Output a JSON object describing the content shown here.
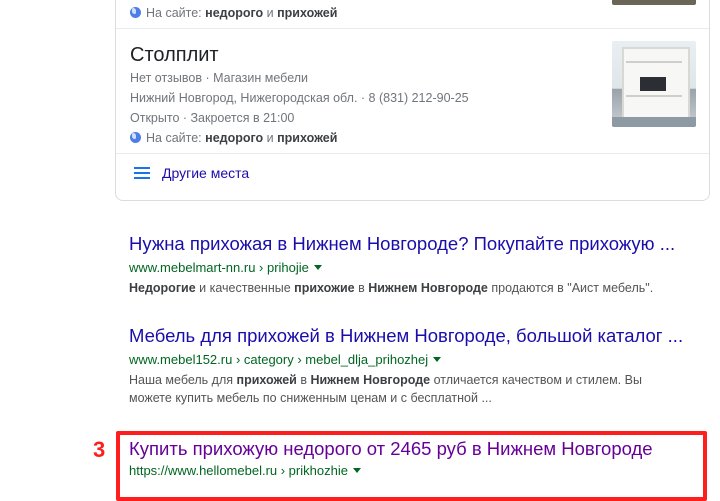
{
  "local_pack": {
    "top_place": {
      "site_label": "На сайте:",
      "site_kw1": "недорого",
      "site_and": "и",
      "site_kw2": "прихожей"
    },
    "place": {
      "name": "Столплит",
      "rating_line": "Нет отзывов · Магазин мебели",
      "address_line": "Нижний Новгород, Нижегородская обл. · 8 (831) 212-90-25",
      "hours_line": "Открыто · Закроется в 21:00",
      "site_label": "На сайте:",
      "site_kw1": "недорого",
      "site_and": "и",
      "site_kw2": "прихожей"
    },
    "more_places": "Другие места"
  },
  "results": [
    {
      "title": "Нужна прихожая в Нижнем Новгороде? Покупайте прихожую ...",
      "url": "www.mebelmart-nn.ru › prihojie",
      "snippet_parts": {
        "p1b": "Недорогие",
        "p2": " и качественные ",
        "p3b": "прихожие",
        "p4": " в ",
        "p5b": "Нижнем Новгороде",
        "p6": " продаются в \"Аист мебель\"."
      }
    },
    {
      "title": "Мебель для прихожей в Нижнем Новгороде, большой каталог ...",
      "url": "www.mebel152.ru › category › mebel_dlja_prihozhej",
      "snippet_parts": {
        "p1": "Наша мебель для ",
        "p2b": "прихожей",
        "p3": " в ",
        "p4b": "Нижнем Новгороде",
        "p5": " отличается качеством и стилем. Вы",
        "line2": "можете купить мебель по сниженным ценам и с бесплатной ..."
      }
    },
    {
      "title": "Купить прихожую недорого от 2465 руб в Нижнем Новгороде",
      "url": "https://www.hellomebel.ru › prikhozhie"
    }
  ],
  "annotation": {
    "number": "3",
    "color": "#ff1e1e"
  }
}
